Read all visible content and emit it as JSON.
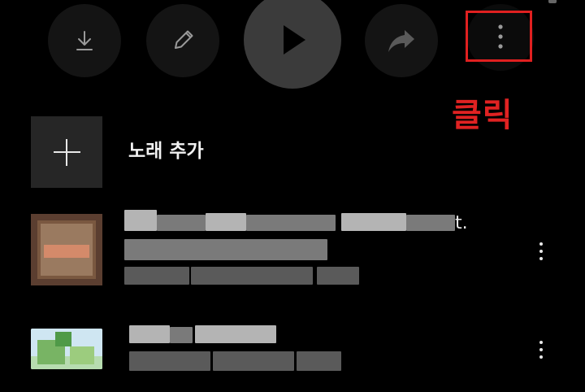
{
  "toolbar": {
    "download": {
      "icon": "download-icon"
    },
    "edit": {
      "icon": "pencil-icon"
    },
    "play": {
      "icon": "play-icon"
    },
    "share": {
      "icon": "share-icon"
    },
    "more": {
      "icon": "more-vertical-icon"
    }
  },
  "annotation": {
    "label": "클릭",
    "color": "#e02020"
  },
  "add_song": {
    "label": "노래 추가",
    "icon": "plus-icon"
  },
  "songs": [
    {
      "title_visible_tail": "t.",
      "thumbnail": "album-art-frame",
      "menu_icon": "more-vertical-icon"
    },
    {
      "thumbnail": "album-art-green",
      "menu_icon": "more-vertical-icon"
    }
  ],
  "colors": {
    "background": "#000000",
    "button_bg": "#141414",
    "play_bg": "#3b3b3b",
    "add_tile_bg": "#262626"
  }
}
